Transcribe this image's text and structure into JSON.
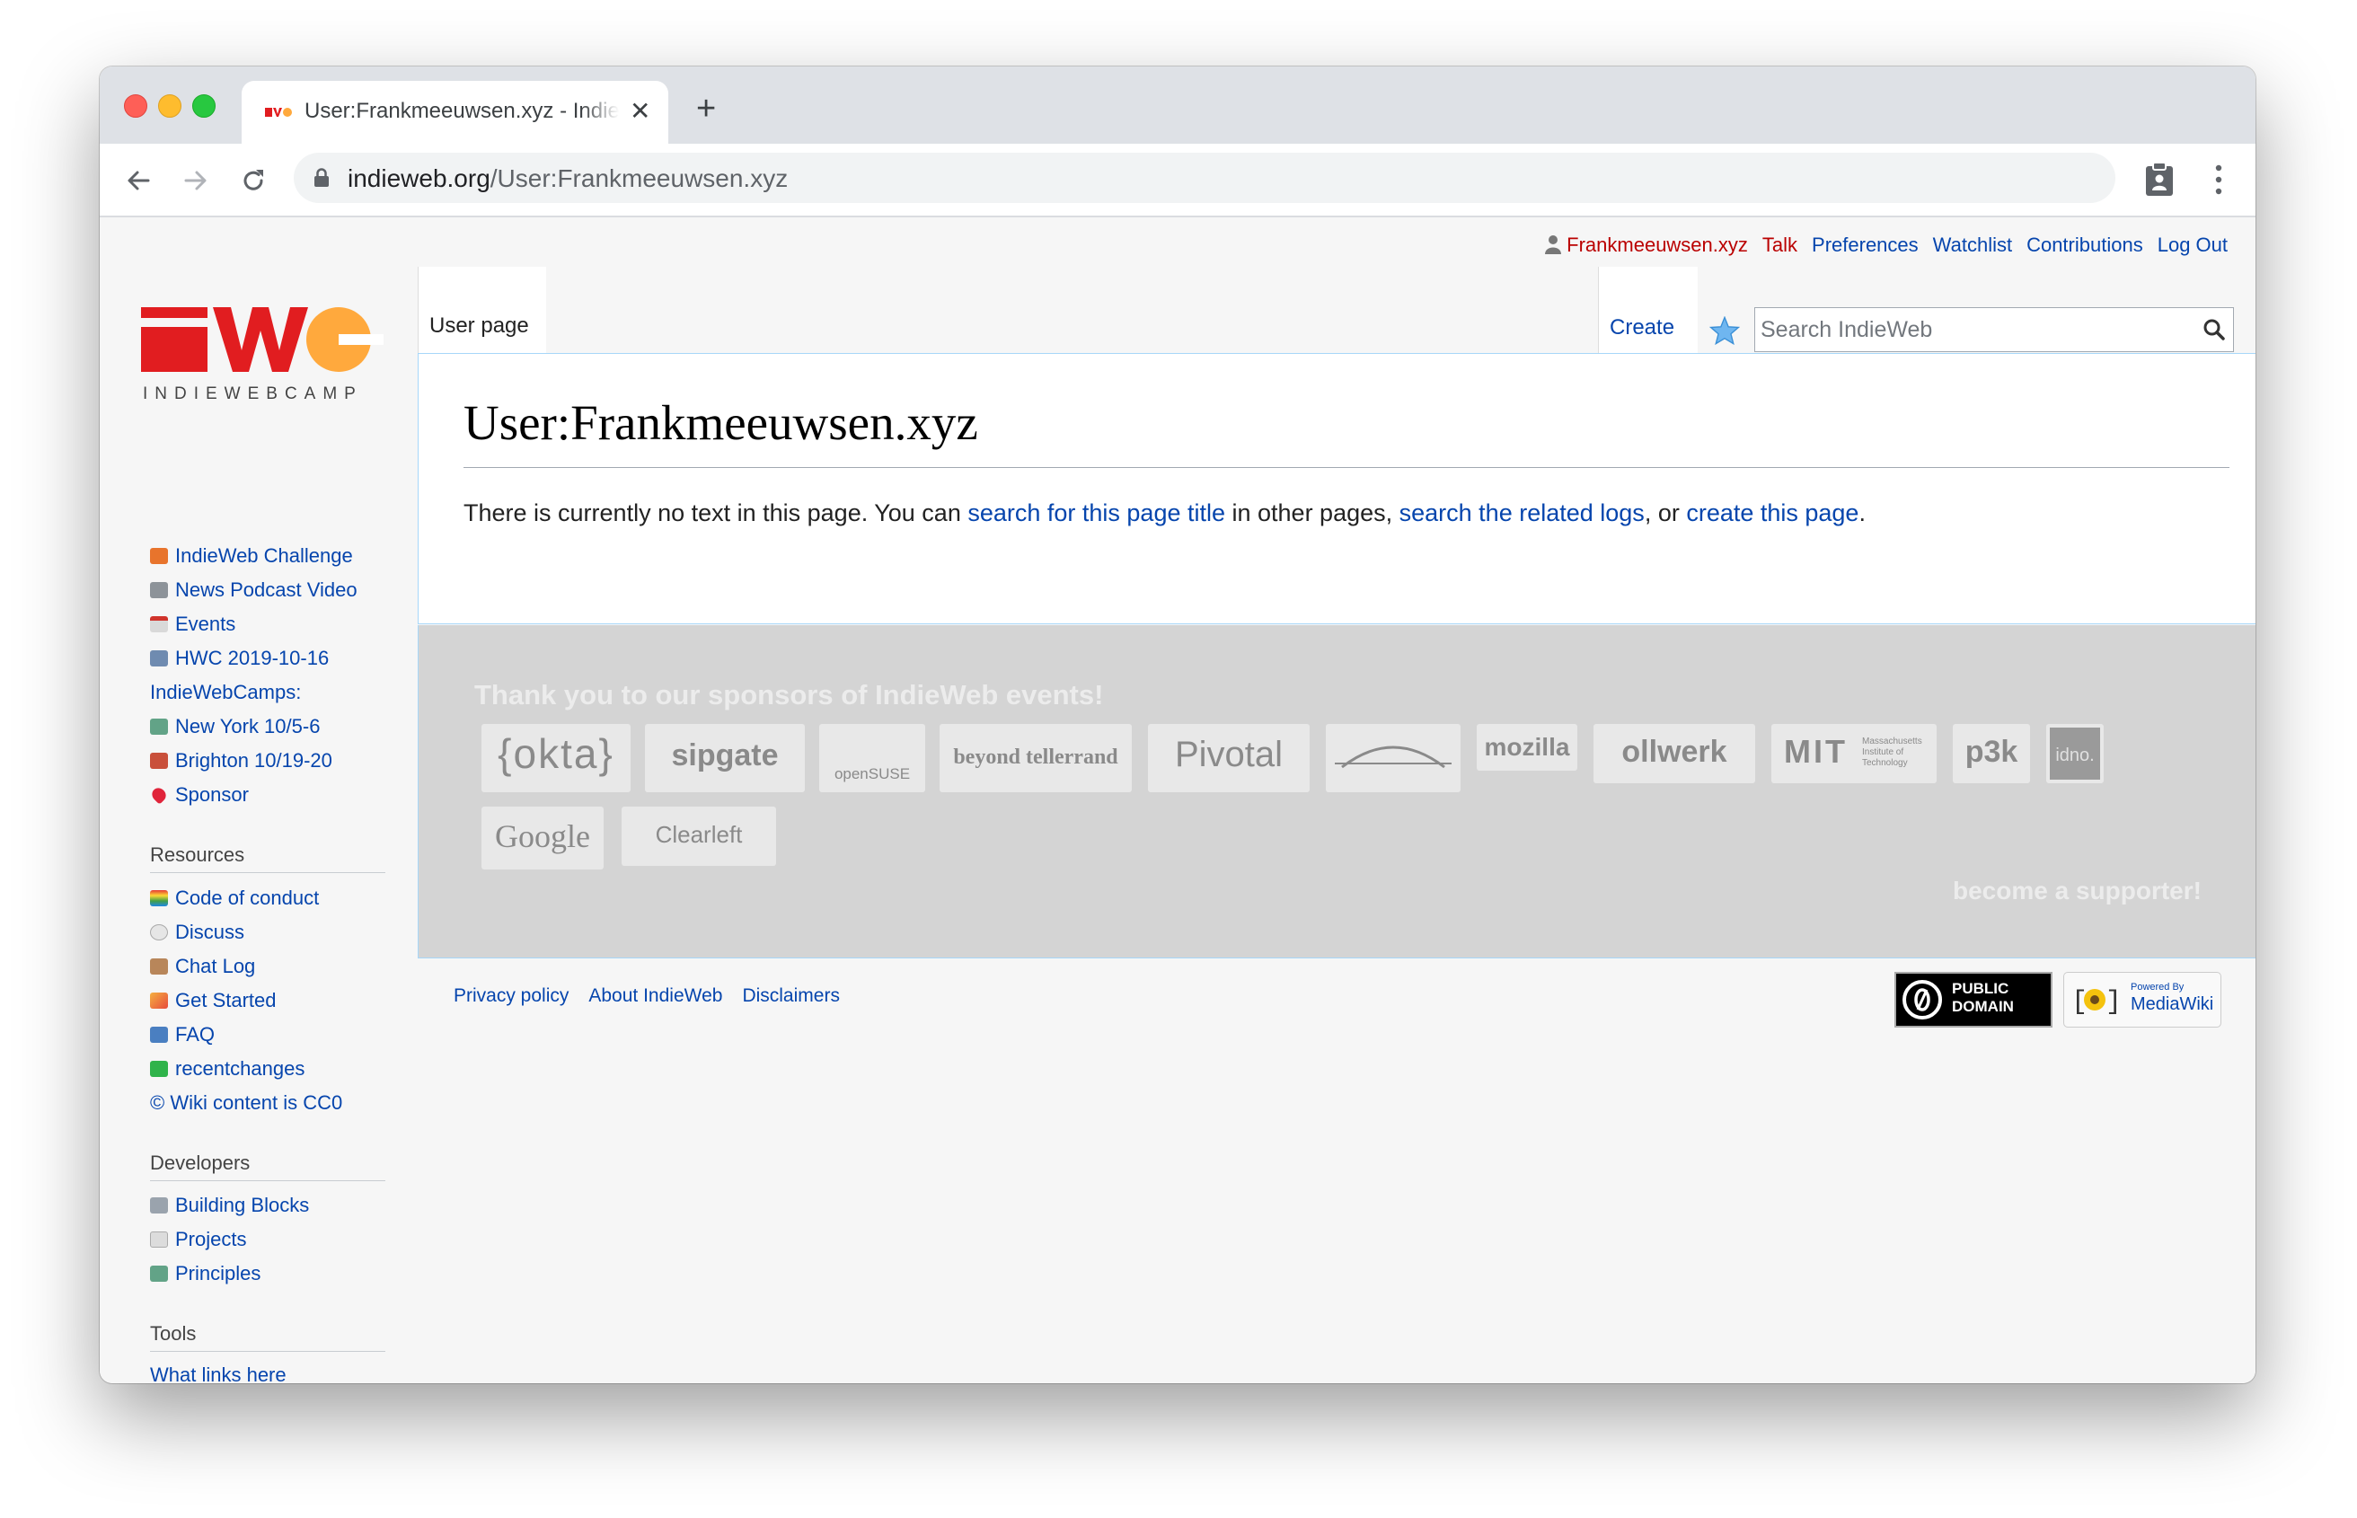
{
  "browser": {
    "tab_title": "User:Frankmeeuwsen.xyz - IndieWeb",
    "url_host": "indieweb.org",
    "url_path": "/User:Frankmeeuwsen.xyz",
    "new_tab_label": "+"
  },
  "personal": {
    "username": "Frankmeeuwsen.xyz",
    "talk": "Talk",
    "preferences": "Preferences",
    "watchlist": "Watchlist",
    "contributions": "Contributions",
    "logout": "Log Out"
  },
  "logo": {
    "subtitle": "INDIEWEBCAMP"
  },
  "sidebar": {
    "nav": [
      {
        "label": "IndieWeb Challenge",
        "icon": "gift-icon"
      },
      {
        "label": "News Podcast Video",
        "icon": "newspaper-icon"
      },
      {
        "label": "Events",
        "icon": "calendar-icon"
      },
      {
        "label": "HWC 2019-10-16",
        "icon": "people-icon"
      }
    ],
    "camps_heading": "IndieWebCamps:",
    "camps": [
      {
        "label": "New York 10/5-6",
        "icon": "statue-icon"
      },
      {
        "label": "Brighton 10/19-20",
        "icon": "pier-icon"
      },
      {
        "label": "Sponsor",
        "icon": "heart-icon"
      }
    ],
    "resources_heading": "Resources",
    "resources": [
      {
        "label": "Code of conduct",
        "icon": "rainbow-icon"
      },
      {
        "label": "Discuss",
        "icon": "speech-bubble-icon"
      },
      {
        "label": "Chat Log",
        "icon": "scroll-icon"
      },
      {
        "label": "Get Started",
        "icon": "party-popper-icon"
      },
      {
        "label": "FAQ",
        "icon": "info-icon"
      },
      {
        "label": "recentchanges",
        "icon": "asterisk-icon"
      }
    ],
    "cc0": "© Wiki content is CC0",
    "developers_heading": "Developers",
    "developers": [
      {
        "label": "Building Blocks",
        "icon": "wrench-icon"
      },
      {
        "label": "Projects",
        "icon": "page-icon"
      },
      {
        "label": "Principles",
        "icon": "statue-icon"
      }
    ],
    "tools_heading": "Tools",
    "tools_first": "What links here"
  },
  "tabs": {
    "user_page": "User page",
    "create": "Create"
  },
  "search": {
    "placeholder": "Search IndieWeb"
  },
  "article": {
    "title": "User:Frankmeeuwsen.xyz",
    "text_1": "There is currently no text in this page. You can ",
    "link_1": "search for this page title",
    "text_2": " in other pages, ",
    "link_2": "search the related logs",
    "text_3": ", or ",
    "link_3": "create this page",
    "text_4": "."
  },
  "sponsors": {
    "title": "Thank you to our sponsors of IndieWeb events!",
    "logos": [
      "{okta}",
      "sipgate",
      "openSUSE",
      "beyond tellerrand",
      "Pivotal",
      "",
      "mozilla",
      "ollwerk",
      "MIT",
      "p3k",
      "idno.",
      "Google",
      "Clearleft"
    ],
    "mit_caption": "Massachusetts Institute of Technology",
    "cta": "become a supporter!"
  },
  "footer": {
    "privacy": "Privacy policy",
    "about": "About IndieWeb",
    "disclaimers": "Disclaimers",
    "pd_line1": "PUBLIC",
    "pd_line2": "DOMAIN",
    "mw_line1": "Powered By",
    "mw_line2": "MediaWiki"
  },
  "colors": {
    "link": "#0645ad",
    "user_link": "#ba0000",
    "logo_red": "#e11d20",
    "logo_orange": "#ffa93d",
    "sponsor_bg": "#d4d4d4"
  }
}
